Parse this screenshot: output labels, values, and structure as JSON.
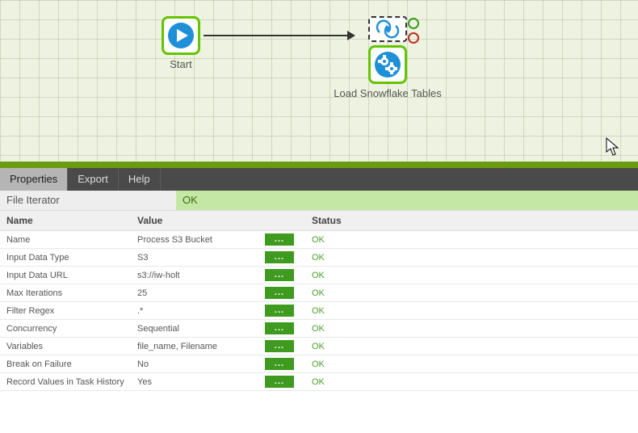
{
  "canvas": {
    "nodes": {
      "start": {
        "label": "Start"
      },
      "load": {
        "label": "Load Snowflake Tables"
      }
    }
  },
  "tabs": {
    "properties": "Properties",
    "export": "Export",
    "help": "Help"
  },
  "component": {
    "name": "File Iterator",
    "status": "OK"
  },
  "grid": {
    "headers": {
      "name": "Name",
      "value": "Value",
      "status": "Status"
    },
    "rows": [
      {
        "name": "Name",
        "value": "Process S3 Bucket",
        "status": "OK"
      },
      {
        "name": "Input Data Type",
        "value": "S3",
        "status": "OK"
      },
      {
        "name": "Input Data URL",
        "value": "s3://iw-holt",
        "status": "OK"
      },
      {
        "name": "Max Iterations",
        "value": "25",
        "status": "OK"
      },
      {
        "name": "Filter Regex",
        "value": ".*",
        "status": "OK"
      },
      {
        "name": "Concurrency",
        "value": "Sequential",
        "status": "OK"
      },
      {
        "name": "Variables",
        "value": "file_name, Filename",
        "status": "OK"
      },
      {
        "name": "Break on Failure",
        "value": "No",
        "status": "OK"
      },
      {
        "name": "Record Values in Task History",
        "value": "Yes",
        "status": "OK"
      }
    ],
    "action_label": "..."
  }
}
